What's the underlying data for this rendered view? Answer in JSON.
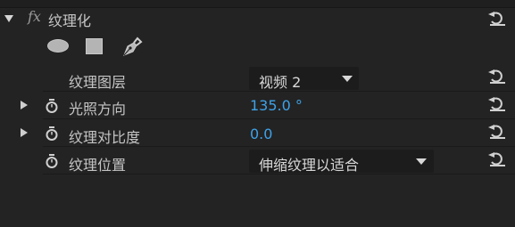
{
  "effect": {
    "title": "纹理化",
    "fx_label": "fx",
    "mask_tools": [
      {
        "name": "ellipse-mask-tool",
        "icon": "ellipse-icon"
      },
      {
        "name": "rectangle-mask-tool",
        "icon": "rectangle-icon"
      },
      {
        "name": "pen-mask-tool",
        "icon": "pen-icon"
      }
    ],
    "properties": {
      "texture_layer": {
        "label": "纹理图层",
        "value": "视频 2"
      },
      "light_direction": {
        "label": "光照方向",
        "value": "135.0 °"
      },
      "texture_contrast": {
        "label": "纹理对比度",
        "value": "0.0"
      },
      "texture_placement": {
        "label": "纹理位置",
        "value": "伸缩纹理以适合"
      }
    }
  },
  "colors": {
    "background": "#232323",
    "value_blue": "#3ea2e8",
    "text": "#c5c5c5"
  },
  "icons": [
    "reset-icon",
    "stopwatch-icon",
    "disclosure-triangle-icon"
  ]
}
